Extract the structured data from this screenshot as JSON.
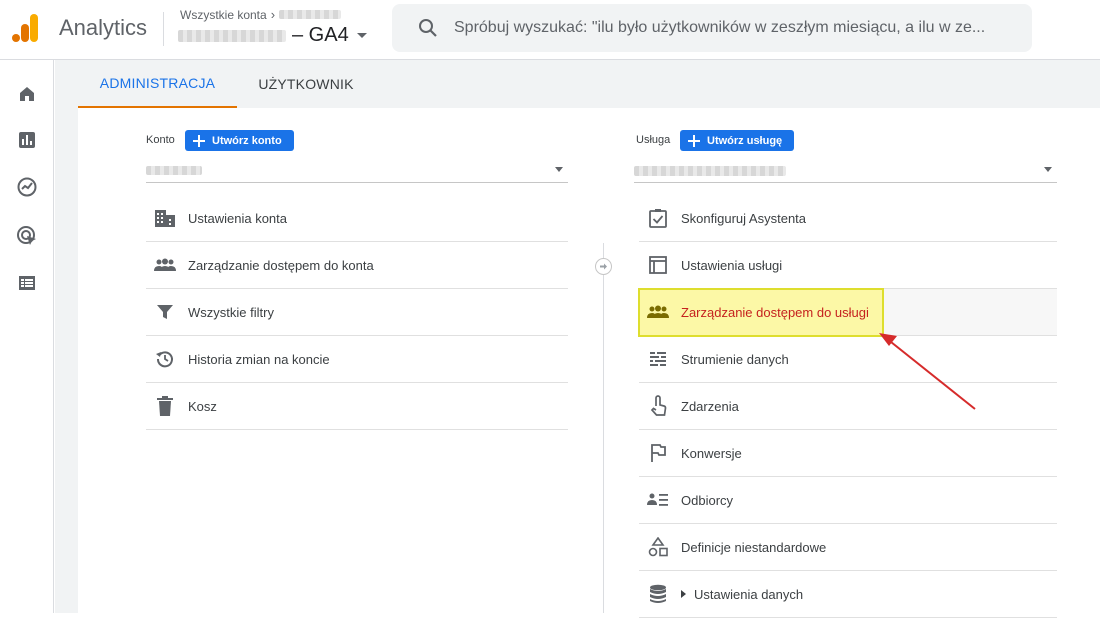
{
  "header": {
    "app_name": "Analytics",
    "account_crumb": "Wszystkie konta",
    "property_suffix": "– GA4",
    "search_placeholder": "Spróbuj wyszukać: \"ilu było użytkowników w zeszłym miesiącu, a ilu w ze..."
  },
  "nav": {
    "items": [
      {
        "icon": "home-icon"
      },
      {
        "icon": "reports-icon"
      },
      {
        "icon": "explore-icon"
      },
      {
        "icon": "advertising-icon"
      },
      {
        "icon": "configure-icon"
      }
    ]
  },
  "tabs": {
    "admin": "ADMINISTRACJA",
    "user": "UŻYTKOWNIK"
  },
  "account": {
    "label": "Konto",
    "create_button": "Utwórz konto",
    "items": [
      {
        "icon": "building-icon",
        "label": "Ustawienia konta"
      },
      {
        "icon": "people-icon",
        "label": "Zarządzanie dostępem do konta"
      },
      {
        "icon": "filter-icon",
        "label": "Wszystkie filtry"
      },
      {
        "icon": "history-icon",
        "label": "Historia zmian na koncie"
      },
      {
        "icon": "trash-icon",
        "label": "Kosz"
      }
    ]
  },
  "property": {
    "label": "Usługa",
    "create_button": "Utwórz usługę",
    "items": [
      {
        "icon": "checklist-icon",
        "label": "Skonfiguruj Asystenta"
      },
      {
        "icon": "window-icon",
        "label": "Ustawienia usługi"
      },
      {
        "icon": "people-icon",
        "label": "Zarządzanie dostępem do usługi",
        "highlighted": true
      },
      {
        "icon": "data-streams-icon",
        "label": "Strumienie danych"
      },
      {
        "icon": "touch-icon",
        "label": "Zdarzenia"
      },
      {
        "icon": "flag-icon",
        "label": "Konwersje"
      },
      {
        "icon": "audience-icon",
        "label": "Odbiorcy"
      },
      {
        "icon": "shapes-icon",
        "label": "Definicje niestandardowe"
      },
      {
        "icon": "database-icon",
        "label": "Ustawienia danych"
      }
    ]
  },
  "colors": {
    "accent": "#1a73e8",
    "tab_underline": "#e37400",
    "highlight_fill": "#fcf8a6",
    "highlight_border": "#dede2e",
    "highlight_text": "#c5221f",
    "annotation_arrow": "#d62b2b"
  }
}
